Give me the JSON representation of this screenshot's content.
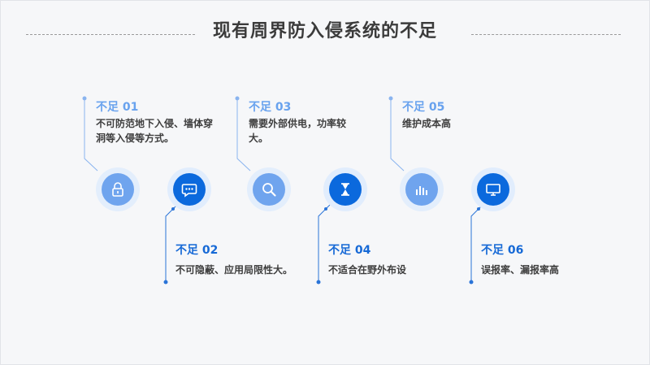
{
  "title": "现有周界防入侵系统的不足",
  "colors": {
    "light": "#6fa4ee",
    "dark": "#0b69dd",
    "line": "#8ab4ef"
  },
  "items": [
    {
      "label": "不足 01",
      "text": "不可防范地下入侵、墙体穿洞等入侵等方式。",
      "icon": "lock-icon"
    },
    {
      "label": "不足 02",
      "text": "不可隐蔽、应用局限性大。",
      "icon": "chat-bubble-icon"
    },
    {
      "label": "不足 03",
      "text": "需要外部供电，功率较大。",
      "icon": "search-icon"
    },
    {
      "label": "不足 04",
      "text": "不适合在野外布设",
      "icon": "hourglass-icon"
    },
    {
      "label": "不足 05",
      "text": "维护成本高",
      "icon": "bar-chart-icon"
    },
    {
      "label": "不足 06",
      "text": "误报率、漏报率高",
      "icon": "monitor-icon"
    }
  ]
}
